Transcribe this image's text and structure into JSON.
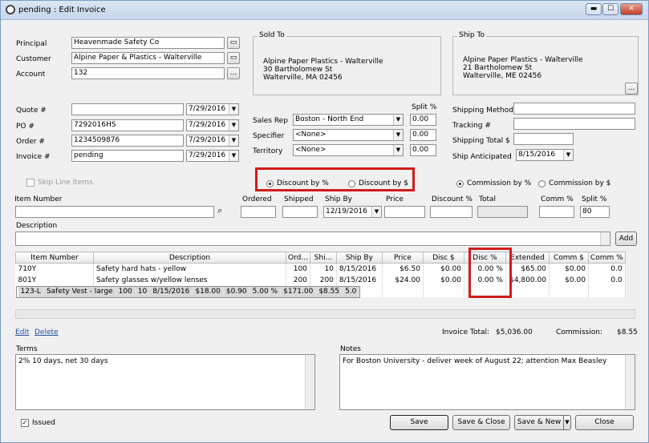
{
  "window": {
    "title": "pending : Edit Invoice",
    "min": "▬",
    "max": "☐",
    "close": "✕"
  },
  "labels": {
    "principal": "Principal",
    "customer": "Customer",
    "account": "Account",
    "quote": "Quote #",
    "po": "PO #",
    "order": "Order #",
    "invoice": "Invoice #",
    "sales_rep": "Sales Rep",
    "specifier": "Specifier",
    "territory": "Territory",
    "split_pct": "Split %",
    "shipping_method": "Shipping Method",
    "tracking": "Tracking #",
    "shipping_total": "Shipping Total $",
    "ship_anticipated": "Ship Anticipated",
    "sold_to": "Sold To",
    "ship_to": "Ship To",
    "skip_line_items": "Skip Line Items",
    "discount_pct": "Discount by %",
    "discount_amt": "Discount by $",
    "commission_pct": "Commission by %",
    "commission_amt": "Commission by $",
    "item_number": "Item Number",
    "ordered": "Ordered",
    "shipped": "Shipped",
    "ship_by": "Ship By",
    "price": "Price",
    "discount_pct_col": "Discount %",
    "total": "Total",
    "comm_pct": "Comm %",
    "split_pct2": "Split %",
    "description": "Description",
    "add": "Add",
    "edit": "Edit",
    "delete": "Delete",
    "invoice_total": "Invoice Total:",
    "commission": "Commission:",
    "terms": "Terms",
    "notes": "Notes",
    "issued": "Issued"
  },
  "fields": {
    "principal": "Heavenmade Safety Co",
    "customer": "Alpine Paper & Plastics - Walterville",
    "account": "132",
    "quote": "",
    "quote_date": "7/29/2016",
    "po": "7292016HS",
    "po_date": "7/29/2016",
    "order": "1234509876",
    "order_date": "7/29/2016",
    "invoice": "pending",
    "invoice_date": "7/29/2016",
    "sales_rep": "Boston - North End",
    "sales_rep_split": "0.00",
    "specifier": "<None>",
    "specifier_split": "0.00",
    "territory": "<None>",
    "territory_split": "0.00",
    "shipping_method": "",
    "tracking": "",
    "shipping_total": "",
    "ship_anticipated": "8/15/2016",
    "item_number": "",
    "ordered": "",
    "shipped": "",
    "ship_by": "12/19/2016",
    "price": "",
    "discount_pct": "",
    "total": "",
    "comm_pct": "",
    "split_pct": "80",
    "description": "",
    "invoice_total": "$5,036.00",
    "commission": "$8.55",
    "terms": "2% 10 days, net 30 days",
    "notes": "For Boston University - deliver week of August 22; attention Max Beasley"
  },
  "sold_to": {
    "line1": "Alpine Paper Plastics - Walterville",
    "line2": "30 Bartholomew St",
    "line3": "Walterville, MA 02456"
  },
  "ship_to": {
    "line1": "Alpine Paper Plastics - Walterville",
    "line2": "21 Bartholomew St",
    "line3": "Walterville, ME 02456"
  },
  "grid": {
    "headers": [
      "Item Number",
      "Description",
      "Ord...",
      "Shi...",
      "Ship By",
      "Price",
      "Disc $",
      "Disc %",
      "Extended",
      "Comm $",
      "Comm %"
    ],
    "rows": [
      [
        "710Y",
        "Safety hard hats - yellow",
        "100",
        "10",
        "8/15/2016",
        "$6.50",
        "$0.00",
        "0.00 %",
        "$65.00",
        "$0.00",
        "0.0"
      ],
      [
        "801Y",
        "Safety glasses w/yellow lenses",
        "200",
        "200",
        "8/15/2016",
        "$24.00",
        "$0.00",
        "0.00 %",
        "$4,800.00",
        "$0.00",
        "0.0"
      ],
      [
        "123-L",
        "Safety Vest - large",
        "100",
        "10",
        "8/15/2016",
        "$18.00",
        "$0.90",
        "5.00 %",
        "$171.00",
        "$8.55",
        "5.0"
      ]
    ]
  },
  "buttons": {
    "save": "Save",
    "save_close": "Save & Close",
    "save_new": "Save & New",
    "close": "Close",
    "ellipsis": "..."
  },
  "colors": {
    "highlight": "#d11b1b",
    "link": "#1d4e9b"
  }
}
